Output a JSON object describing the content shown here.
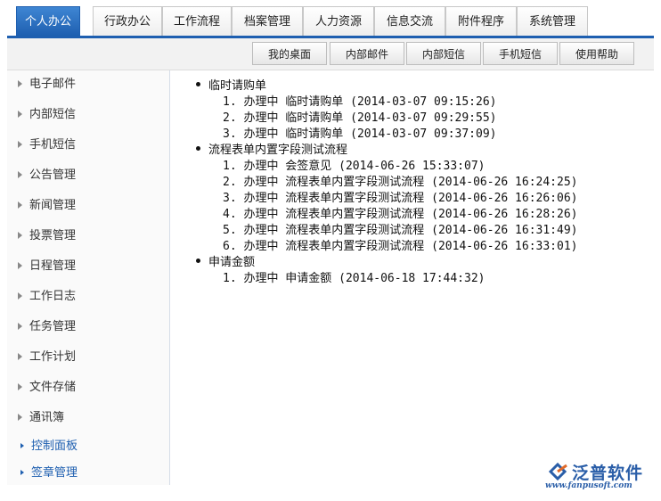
{
  "top_tabs": [
    {
      "label": "个人办公",
      "active": true
    },
    {
      "label": "行政办公",
      "active": false
    },
    {
      "label": "工作流程",
      "active": false
    },
    {
      "label": "档案管理",
      "active": false
    },
    {
      "label": "人力资源",
      "active": false
    },
    {
      "label": "信息交流",
      "active": false
    },
    {
      "label": "附件程序",
      "active": false
    },
    {
      "label": "系统管理",
      "active": false
    }
  ],
  "sub_tabs": [
    "我的桌面",
    "内部邮件",
    "内部短信",
    "手机短信",
    "使用帮助"
  ],
  "sidebar": {
    "items": [
      "电子邮件",
      "内部短信",
      "手机短信",
      "公告管理",
      "新闻管理",
      "投票管理",
      "日程管理",
      "工作日志",
      "任务管理",
      "工作计划",
      "文件存储",
      "通讯簿"
    ],
    "sub_items": [
      "控制面板",
      "签章管理"
    ]
  },
  "workflow_groups": [
    {
      "title": "临时请购单",
      "items": [
        "1. 办理中 临时请购单 (2014-03-07 09:15:26)",
        "2. 办理中 临时请购单 (2014-03-07 09:29:55)",
        "3. 办理中 临时请购单 (2014-03-07 09:37:09)"
      ]
    },
    {
      "title": "流程表单内置字段测试流程",
      "items": [
        "1. 办理中 会签意见 (2014-06-26 15:33:07)",
        "2. 办理中 流程表单内置字段测试流程 (2014-06-26 16:24:25)",
        "3. 办理中 流程表单内置字段测试流程 (2014-06-26 16:26:06)",
        "4. 办理中 流程表单内置字段测试流程 (2014-06-26 16:28:26)",
        "5. 办理中 流程表单内置字段测试流程 (2014-06-26 16:31:49)",
        "6. 办理中 流程表单内置字段测试流程 (2014-06-26 16:33:01)"
      ]
    },
    {
      "title": "申请金额",
      "items": [
        "1. 办理中 申请金额 (2014-06-18 17:44:32)"
      ]
    }
  ],
  "logo": {
    "name": "泛普软件",
    "url": "www.fanpusoft.com",
    "color": "#2a5ea8"
  },
  "colors": {
    "accent": "#1e5fb0"
  }
}
